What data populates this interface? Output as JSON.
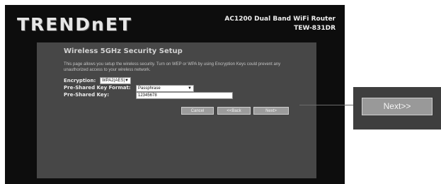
{
  "brand": {
    "logo_text": "TRENDnET",
    "product_line": "AC1200 Dual Band WiFi Router",
    "model": "TEW-831DR"
  },
  "page": {
    "title": "Wireless 5GHz Security Setup",
    "description": "This page allows you setup the wireless security. Turn on WEP or WPA by using Encryption Keys could prevent any unauthorized access to your wireless network."
  },
  "form": {
    "encryption": {
      "label": "Encryption:",
      "value": "WPA2(AES)"
    },
    "key_format": {
      "label": "Pre-Shared Key Format:",
      "value": "Passphrase"
    },
    "psk": {
      "label": "Pre-Shared Key:",
      "value": "12345678"
    }
  },
  "buttons": {
    "cancel": "Cancel",
    "back": "<<Back",
    "next": "Next>"
  },
  "callout": {
    "next_label": "Next>>"
  }
}
